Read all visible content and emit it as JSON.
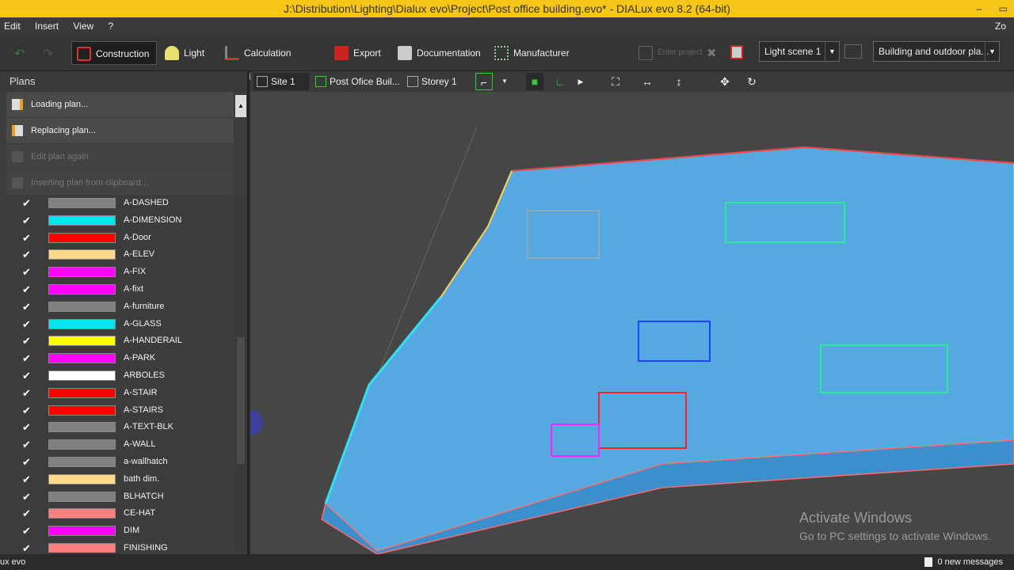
{
  "window": {
    "title": "J:\\Distribution\\Lighting\\Dialux evo\\Project\\Post office building.evo* - DIALux evo 8.2  (64-bit)",
    "minimize": "–",
    "restore": "▭"
  },
  "menu": {
    "items": [
      "Edit",
      "Insert",
      "View",
      "?"
    ],
    "zoom": "Zo"
  },
  "toolbar": {
    "construction": "Construction",
    "light": "Light",
    "calc_objects": "Calculation objects",
    "export": "Export",
    "documentation": "Documentation",
    "manufacturer": "Manufacturer",
    "enter_project": "Enter project",
    "light_scene": "Light scene 1",
    "building_combo": "Building and outdoor pla..."
  },
  "plans": {
    "title": "Plans",
    "actions": [
      {
        "label": "Loading plan...",
        "enabled": true
      },
      {
        "label": "Replacing plan...",
        "enabled": true
      },
      {
        "label": "Edit plan again",
        "enabled": false
      },
      {
        "label": "Inserting plan from clipboard...",
        "enabled": false
      }
    ],
    "layers": [
      {
        "name": "A-DASHED",
        "color": "#808080"
      },
      {
        "name": "A-DIMENSION",
        "color": "#00e5ee"
      },
      {
        "name": "A-Door",
        "color": "#ff0000"
      },
      {
        "name": "A-ELEV",
        "color": "#ffd98a"
      },
      {
        "name": "A-FIX",
        "color": "#ff00ff"
      },
      {
        "name": "A-fixt",
        "color": "#ff00ff"
      },
      {
        "name": "A-furniture",
        "color": "#808080"
      },
      {
        "name": "A-GLASS",
        "color": "#00e5ee"
      },
      {
        "name": "A-HANDERAIL",
        "color": "#ffff00"
      },
      {
        "name": "A-PARK",
        "color": "#ff00ff"
      },
      {
        "name": "ARBOLES",
        "color": "#ffffff"
      },
      {
        "name": "A-STAIR",
        "color": "#ff0000"
      },
      {
        "name": "A-STAIRS",
        "color": "#ff0000"
      },
      {
        "name": "A-TEXT-BLK",
        "color": "#808080"
      },
      {
        "name": "A-WALL",
        "color": "#808080"
      },
      {
        "name": "a-wallhatch",
        "color": "#808080"
      },
      {
        "name": "bath dim.",
        "color": "#ffd98a"
      },
      {
        "name": "BLHATCH",
        "color": "#808080"
      },
      {
        "name": "CE-HAT",
        "color": "#ff7f7f"
      },
      {
        "name": "DIM",
        "color": "#ff00ff"
      },
      {
        "name": "FINISHING",
        "color": "#ff7f7f"
      }
    ],
    "check_glyph": "✔"
  },
  "view": {
    "tabs": [
      "Site 1",
      "Post Ofice Buil...",
      "Storey 1"
    ]
  },
  "status": {
    "logo": "ux evo",
    "messages": "0 new messages"
  },
  "watermark": {
    "line1": "Activate Windows",
    "line2": "Go to PC settings to activate Windows."
  }
}
